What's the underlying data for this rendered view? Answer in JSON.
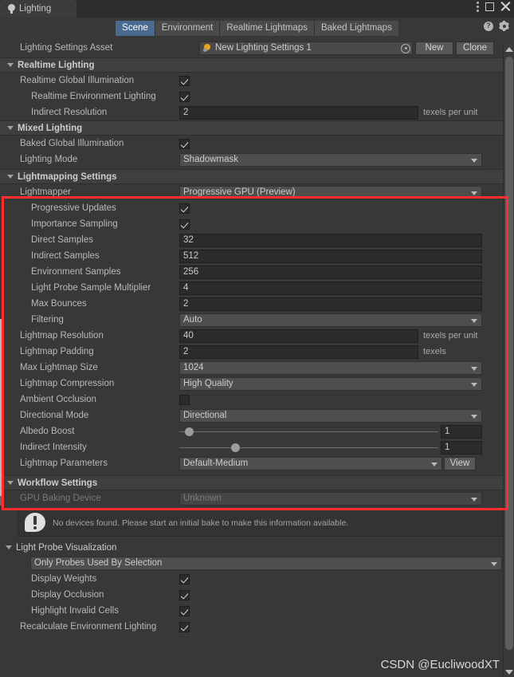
{
  "window": {
    "tab_title": "Lighting",
    "tab_icon": "lightbulb-icon",
    "menu_icon": "kebab-menu-icon",
    "maximize_icon": "maximize-icon",
    "close_icon": "close-icon"
  },
  "toolbar": {
    "tabs": [
      {
        "label": "Scene",
        "active": true
      },
      {
        "label": "Environment",
        "active": false
      },
      {
        "label": "Realtime Lightmaps",
        "active": false
      },
      {
        "label": "Baked Lightmaps",
        "active": false
      }
    ],
    "help_icon": "help-icon",
    "settings_icon": "gear-icon"
  },
  "asset_row": {
    "label": "Lighting Settings Asset",
    "value": "New Lighting Settings 1",
    "object_icon": "lighting-settings-asset-icon",
    "picker_icon": "object-picker-icon",
    "new_button": "New",
    "clone_button": "Clone"
  },
  "sections": {
    "realtime_lighting": {
      "title": "Realtime Lighting",
      "rows": [
        {
          "label": "Realtime Global Illumination",
          "type": "checkbox",
          "value": true
        },
        {
          "label": "Realtime Environment Lighting",
          "type": "checkbox",
          "value": true
        },
        {
          "label": "Indirect Resolution",
          "type": "number",
          "value": "2",
          "unit": "texels per unit"
        }
      ]
    },
    "mixed_lighting": {
      "title": "Mixed Lighting",
      "rows": [
        {
          "label": "Baked Global Illumination",
          "type": "checkbox",
          "value": true
        },
        {
          "label": "Lighting Mode",
          "type": "dropdown",
          "value": "Shadowmask"
        }
      ]
    },
    "lightmapping_settings": {
      "title": "Lightmapping Settings",
      "highlighted": true,
      "rows": [
        {
          "label": "Lightmapper",
          "type": "dropdown",
          "value": "Progressive GPU (Preview)"
        },
        {
          "label": "Progressive Updates",
          "type": "checkbox",
          "value": true
        },
        {
          "label": "Importance Sampling",
          "type": "checkbox",
          "value": true
        },
        {
          "label": "Direct Samples",
          "type": "number",
          "value": "32"
        },
        {
          "label": "Indirect Samples",
          "type": "number",
          "value": "512"
        },
        {
          "label": "Environment Samples",
          "type": "number",
          "value": "256"
        },
        {
          "label": "Light Probe Sample Multiplier",
          "type": "number",
          "value": "4"
        },
        {
          "label": "Max Bounces",
          "type": "number",
          "value": "2"
        },
        {
          "label": "Filtering",
          "type": "dropdown",
          "value": "Auto"
        },
        {
          "label": "Lightmap Resolution",
          "type": "number",
          "value": "40",
          "unit": "texels per unit"
        },
        {
          "label": "Lightmap Padding",
          "type": "number",
          "value": "2",
          "unit": "texels"
        },
        {
          "label": "Max Lightmap Size",
          "type": "dropdown",
          "value": "1024"
        },
        {
          "label": "Lightmap Compression",
          "type": "dropdown",
          "value": "High Quality"
        },
        {
          "label": "Ambient Occlusion",
          "type": "checkbox",
          "value": false
        },
        {
          "label": "Directional Mode",
          "type": "dropdown",
          "value": "Directional"
        },
        {
          "label": "Albedo Boost",
          "type": "slider",
          "value": "1",
          "fill_percent": 2
        },
        {
          "label": "Indirect Intensity",
          "type": "slider",
          "value": "1",
          "fill_percent": 20
        },
        {
          "label": "Lightmap Parameters",
          "type": "dropdown_with_button",
          "value": "Default-Medium",
          "button": "View"
        }
      ]
    },
    "workflow_settings": {
      "title": "Workflow Settings",
      "rows": [
        {
          "label": "GPU Baking Device",
          "type": "dropdown",
          "value": "Unknown",
          "disabled": true
        }
      ],
      "info": {
        "icon": "warning-icon",
        "text": "No devices found. Please start an initial bake to make this information available."
      }
    },
    "light_probe_visualization": {
      "title": "Light Probe Visualization",
      "mode": "Only Probes Used By Selection",
      "rows": [
        {
          "label": "Display Weights",
          "type": "checkbox",
          "value": true
        },
        {
          "label": "Display Occlusion",
          "type": "checkbox",
          "value": true
        },
        {
          "label": "Highlight Invalid Cells",
          "type": "checkbox",
          "value": true
        },
        {
          "label": "Recalculate Environment Lighting",
          "type": "checkbox",
          "value": true
        }
      ]
    }
  },
  "annotation": {
    "highlight_color": "#ff2d2d"
  },
  "watermark": "CSDN @EucliwoodXT"
}
